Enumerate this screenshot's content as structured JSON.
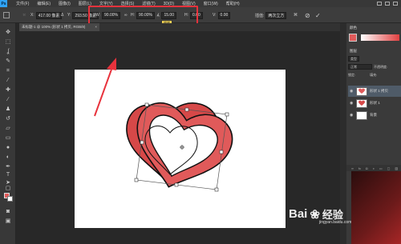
{
  "app": {
    "logo_text": "Ps"
  },
  "menubar": {
    "items": [
      "文件(F)",
      "编辑(E)",
      "图像(I)",
      "图层(L)",
      "文字(Y)",
      "选择(S)",
      "滤镜(T)",
      "3D(D)",
      "视图(V)",
      "窗口(W)",
      "帮助(H)"
    ]
  },
  "options_bar": {
    "x_label": "X:",
    "x_value": "417.00 像素",
    "y_label": "Y:",
    "y_value": "293.50 像素",
    "w_label": "W:",
    "w_value": "90.00%",
    "h_label": "H:",
    "h_value": "90.00%",
    "angle_value": "15.00",
    "h_skew_label": "H:",
    "h_skew_value": "0.00",
    "v_skew_label": "V:",
    "v_skew_value": "0.00",
    "interp_label": "插值:",
    "interp_value": "两次立方",
    "tooltip": "旋转"
  },
  "document_tab": {
    "title": "未标题-1 @ 100% (形状 1 拷贝, RGB/8)",
    "close": "×"
  },
  "color_panel": {
    "tab": "颜色",
    "foreground": "#e05a5a"
  },
  "layers_panel": {
    "title": "图层",
    "kind_filter": "类型",
    "blend_mode": "正常",
    "opacity_label": "不透明度:",
    "lock_label": "锁定:",
    "fill_label": "填充:",
    "layers": [
      {
        "name": "形状 1 拷贝",
        "active": true
      },
      {
        "name": "形状 1",
        "active": false
      },
      {
        "name": "背景",
        "active": false
      }
    ],
    "bottom_icons": [
      "link-icon",
      "fx-icon",
      "mask-icon",
      "adjust-icon",
      "folder-icon",
      "new-layer-icon",
      "trash-icon"
    ]
  },
  "watermark": {
    "text": "Bai",
    "cn": "经验",
    "url": "jingyan.baidu.com"
  },
  "colors": {
    "accent_red": "#e8323c",
    "heart_fill": "#e05a5a",
    "heart_back": "#d54a4a"
  }
}
